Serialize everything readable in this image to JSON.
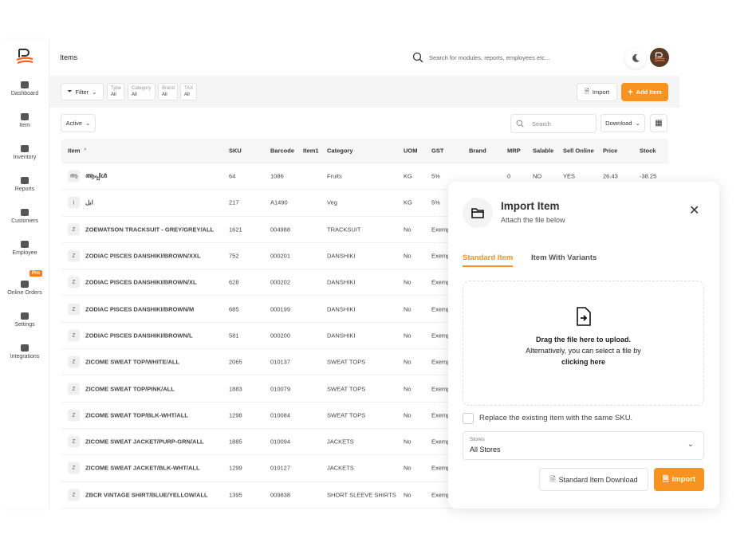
{
  "sidebar": {
    "items": [
      {
        "label": "Dashboard",
        "icon": "camera-icon"
      },
      {
        "label": "Item",
        "icon": "box-icon"
      },
      {
        "label": "Inventory",
        "icon": "boxes-icon"
      },
      {
        "label": "Reports",
        "icon": "pie-icon"
      },
      {
        "label": "Customers",
        "icon": "customer-icon"
      },
      {
        "label": "Employee",
        "icon": "users-icon"
      },
      {
        "label": "Online Orders",
        "icon": "briefcase-icon",
        "badge": "Pro"
      },
      {
        "label": "Settings",
        "icon": "gear-icon"
      },
      {
        "label": "Integrations",
        "icon": "plug-icon"
      }
    ]
  },
  "header": {
    "title": "Items",
    "search_placeholder": "Search for modules, reports, employees etc..."
  },
  "filters": {
    "filter_label": "Filter",
    "chips": [
      {
        "label": "Type",
        "value": "All"
      },
      {
        "label": "Category",
        "value": "All"
      },
      {
        "label": "Brand",
        "value": "All"
      },
      {
        "label": "TAX",
        "value": "All"
      }
    ],
    "import_label": "Import",
    "add_label": "Add Item"
  },
  "toolbar": {
    "status": "Active",
    "search_placeholder": "Search",
    "download_label": "Download"
  },
  "table": {
    "columns": [
      "Item",
      "SKU",
      "Barcode",
      "Item1",
      "Category",
      "UOM",
      "GST",
      "Brand",
      "MRP",
      "Salable",
      "Sell Online",
      "Price",
      "Stock"
    ],
    "rows": [
      {
        "badge": "ആ",
        "item": "ആപ്പിൾ",
        "sku": "64",
        "barcode": "1086",
        "item1": "",
        "category": "Fruits",
        "uom": "KG",
        "gst": "5%",
        "brand": "",
        "mrp": "0",
        "salable": "NO",
        "sell_online": "YES",
        "price": "26.43",
        "stock": "-38.25"
      },
      {
        "badge": "ا",
        "item": "ابل",
        "sku": "217",
        "barcode": "A1490",
        "item1": "",
        "category": "Veg",
        "uom": "KG",
        "gst": "5%"
      },
      {
        "badge": "Z",
        "item": "ZOEWATSON TRACKSUIT - GREY/GREY/ALL",
        "sku": "1621",
        "barcode": "004988",
        "category": "TRACKSUIT",
        "uom": "No",
        "gst": "Exempt"
      },
      {
        "badge": "Z",
        "item": "ZODIAC PISCES DANSHIKI/BROWN/XXL",
        "sku": "752",
        "barcode": "000201",
        "category": "DANSHIKI",
        "uom": "No",
        "gst": "Exempt"
      },
      {
        "badge": "Z",
        "item": "ZODIAC PISCES DANSHIKI/BROWN/XL",
        "sku": "628",
        "barcode": "000202",
        "category": "DANSHIKI",
        "uom": "No",
        "gst": "Exempt"
      },
      {
        "badge": "Z",
        "item": "ZODIAC PISCES DANSHIKI/BROWN/M",
        "sku": "685",
        "barcode": "000199",
        "category": "DANSHIKI",
        "uom": "No",
        "gst": "Exempt"
      },
      {
        "badge": "Z",
        "item": "ZODIAC PISCES DANSHIKI/BROWN/L",
        "sku": "581",
        "barcode": "000200",
        "category": "DANSHIKI",
        "uom": "No",
        "gst": "Exempt"
      },
      {
        "badge": "Z",
        "item": "ZICOME SWEAT TOP/WHITE/ALL",
        "sku": "2065",
        "barcode": "010137",
        "category": "SWEAT TOPS",
        "uom": "No",
        "gst": "Exempt"
      },
      {
        "badge": "Z",
        "item": "ZICOME SWEAT TOP/PINK/ALL",
        "sku": "1883",
        "barcode": "010079",
        "category": "SWEAT TOPS",
        "uom": "No",
        "gst": "Exempt"
      },
      {
        "badge": "Z",
        "item": "ZICOME SWEAT TOP/BLK-WHT/ALL",
        "sku": "1298",
        "barcode": "010084",
        "category": "SWEAT TOPS",
        "uom": "No",
        "gst": "Exempt"
      },
      {
        "badge": "Z",
        "item": "ZICOME SWEAT JACKET/PURP-GRN/ALL",
        "sku": "1885",
        "barcode": "010094",
        "category": "JACKETS",
        "uom": "No",
        "gst": "Exempt"
      },
      {
        "badge": "Z",
        "item": "ZICOME SWEAT JACKET/BLK-WHT/ALL",
        "sku": "1299",
        "barcode": "010127",
        "category": "JACKETS",
        "uom": "No",
        "gst": "Exempt"
      },
      {
        "badge": "Z",
        "item": "ZBCR VINTAGE SHIRT/BLUE/YELLOW/ALL",
        "sku": "1395",
        "barcode": "009838",
        "category": "SHORT SLEEVE SHIRTS",
        "uom": "No",
        "gst": "Exempt"
      }
    ]
  },
  "modal": {
    "title": "Import Item",
    "subtitle": "Attach the file below",
    "tabs": [
      "Standard Item",
      "Item With Variants"
    ],
    "drop_title": "Drag the file here to upload.",
    "drop_text": "Alternatively, you can select a file by",
    "drop_link": "clicking here",
    "replace_label": "Replace the existing item with the same SKU.",
    "stores_label": "Stores",
    "stores_value": "All Stores",
    "download_label": "Standard Item Download",
    "import_label": "Import"
  },
  "colors": {
    "accent": "#f7931e",
    "pro": "#f57c1f"
  }
}
